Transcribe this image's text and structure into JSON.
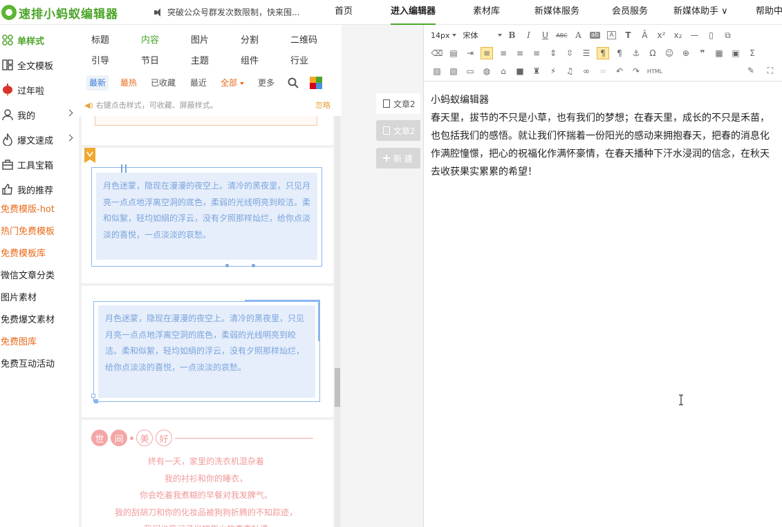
{
  "app": {
    "logo_text": "速排小蚂蚁编辑器"
  },
  "header": {
    "notice": "突破公众号群发次数限制，快来围...",
    "nav": [
      {
        "label": "首页"
      },
      {
        "label": "进入编辑器"
      },
      {
        "label": "素材库"
      },
      {
        "label": "新媒体服务"
      },
      {
        "label": "会员服务"
      },
      {
        "label": "新媒体助手 ∨"
      },
      {
        "label": "帮助中"
      }
    ]
  },
  "sidebar": {
    "items": [
      {
        "label": "单样式"
      },
      {
        "label": "全文模板"
      },
      {
        "label": "过年啦"
      },
      {
        "label": "我的"
      },
      {
        "label": "爆文速成"
      },
      {
        "label": "工具宝箱"
      },
      {
        "label": "我的推荐"
      }
    ],
    "links": [
      {
        "label": "免费模版-hot"
      },
      {
        "label": "热门免费模板"
      },
      {
        "label": "免费模板库"
      },
      {
        "label": "微信文章分类"
      },
      {
        "label": "图片素材"
      },
      {
        "label": "免费爆文素材"
      },
      {
        "label": "免费图库"
      },
      {
        "label": "免费互动活动"
      }
    ]
  },
  "styles_panel": {
    "categories": [
      "标题",
      "内容",
      "图片",
      "分割",
      "二维码",
      "引导",
      "节日",
      "主题",
      "组件",
      "行业"
    ],
    "filters": [
      "最新",
      "最热",
      "已收藏",
      "最近",
      "全部",
      "更多"
    ],
    "hint": "右键点击样式，可收藏、屏蔽样式。",
    "ignore": "忽略",
    "card_text": "月色迷蒙，隐现在漫漫的夜空上。清冷的黑夜里，只见月亮一点点地浮离空洞的底色，柔弱的光线明亮到皎洁。柔和似絮，轻均如绢的浮云，没有夕照那样灿烂，给你点淡淡的喜悦，一点淡淡的哀愁。",
    "poem_tags": [
      "世",
      "间",
      "美",
      "好"
    ],
    "poem_lines": [
      "终有一天，家里的洗衣机混杂着",
      "我的衬衫和你的睡衣，",
      "你会吃着我煮糊的早餐对我发脾气。",
      "我的刮胡刀和你的化妆品被狗狗折腾的不知踪迹，",
      "我们也忘记了当初年少的真真牡遗"
    ]
  },
  "doc_tabs": [
    {
      "label": "文章2"
    },
    {
      "label": "文章2"
    },
    {
      "label": "新 建"
    }
  ],
  "toolbar": {
    "font_size": "14px",
    "font_family": "宋体",
    "html_label": "HTML"
  },
  "editor": {
    "heading": "小蚂蚁编辑器",
    "body": "春天里，拔节的不只是小草，也有我们的梦想；在春天里，成长的不只是禾苗，也包括我们的感悟。就让我们怀揣着一份阳光的感动来拥抱春天，把春的消息化作满腔憧憬，把心的祝福化作满怀豪情，在春天播种下汗水浸润的信念，在秋天去收获果实累累的希望！"
  },
  "colors": {
    "brand": "#4ca52a",
    "orange": "#e86a1a",
    "blue_text": "#7aa4dc",
    "pink": "#f09a9a"
  }
}
